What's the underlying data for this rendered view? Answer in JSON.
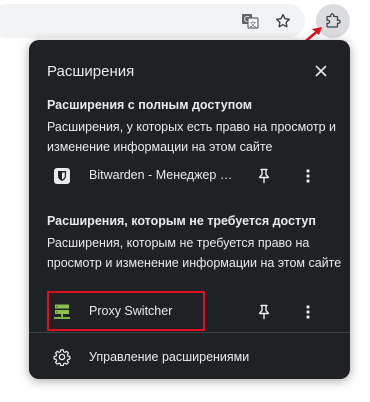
{
  "popup": {
    "title": "Расширения",
    "full_access": {
      "heading": "Расширения с полным доступом",
      "description": "Расширения, у которых есть право на просмотр и изменение информации на этом сайте",
      "items": [
        {
          "name": "Bitwarden - Менеджер паролей",
          "icon": "bitwarden-shield-icon"
        }
      ]
    },
    "no_access": {
      "heading": "Расширения, которым не требуется доступ",
      "description": "Расширения, которым не требуется право на просмотр и изменение информации на этом сайте",
      "items": [
        {
          "name": "Proxy Switcher",
          "icon": "proxy-switcher-icon"
        }
      ]
    },
    "manage_label": "Управление расширениями"
  },
  "colors": {
    "popup_bg": "#202124",
    "text": "#e8eaed",
    "highlight": "#e0101f",
    "proxy_icon": "#8bc34a"
  }
}
